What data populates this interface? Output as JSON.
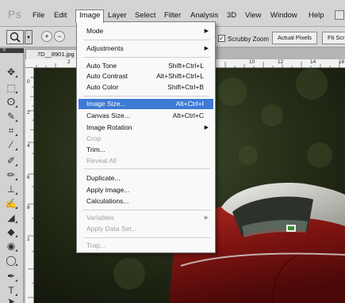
{
  "app_logo": "Ps",
  "menubar": {
    "items": [
      "File",
      "Edit",
      "Image",
      "Layer",
      "Select",
      "Filter",
      "Analysis",
      "3D",
      "View",
      "Window",
      "Help"
    ]
  },
  "options_bar": {
    "scrubby_zoom_label": "Scrubby Zoom",
    "scrubby_zoom_checked": true,
    "actual_pixels_label": "Actual Pixels",
    "fit_screen_label": "Fit Scr"
  },
  "document": {
    "tab_label": "7D__8901.jpg",
    "ruler_h_numbers": [
      "2",
      "10",
      "12",
      "14",
      "16"
    ],
    "ruler_v_numbers": [
      "0",
      "2",
      "4",
      "6",
      "8",
      "1"
    ]
  },
  "image_menu": {
    "items": [
      {
        "label": "Mode",
        "submenu": true
      },
      {
        "label": "Adjustments",
        "submenu": true
      },
      {
        "label": "Auto Tone",
        "shortcut": "Shift+Ctrl+L"
      },
      {
        "label": "Auto Contrast",
        "shortcut": "Alt+Shift+Ctrl+L"
      },
      {
        "label": "Auto Color",
        "shortcut": "Shift+Ctrl+B"
      },
      {
        "label": "Image Size...",
        "shortcut": "Alt+Ctrl+I",
        "highlighted": true
      },
      {
        "label": "Canvas Size...",
        "shortcut": "Alt+Ctrl+C"
      },
      {
        "label": "Image Rotation",
        "submenu": true
      },
      {
        "label": "Crop",
        "disabled": true
      },
      {
        "label": "Trim..."
      },
      {
        "label": "Reveal All",
        "disabled": true
      },
      {
        "label": "Duplicate..."
      },
      {
        "label": "Apply Image..."
      },
      {
        "label": "Calculations..."
      },
      {
        "label": "Variables",
        "submenu": true,
        "disabled": true
      },
      {
        "label": "Apply Data Set...",
        "disabled": true
      },
      {
        "label": "Trap...",
        "disabled": true
      }
    ]
  },
  "icons": {
    "submenu_arrow": "submenu-arrow-icon",
    "check": "checkmark-icon"
  },
  "colors": {
    "highlight": "#3d7ad4",
    "car_red": "#8a1414"
  }
}
